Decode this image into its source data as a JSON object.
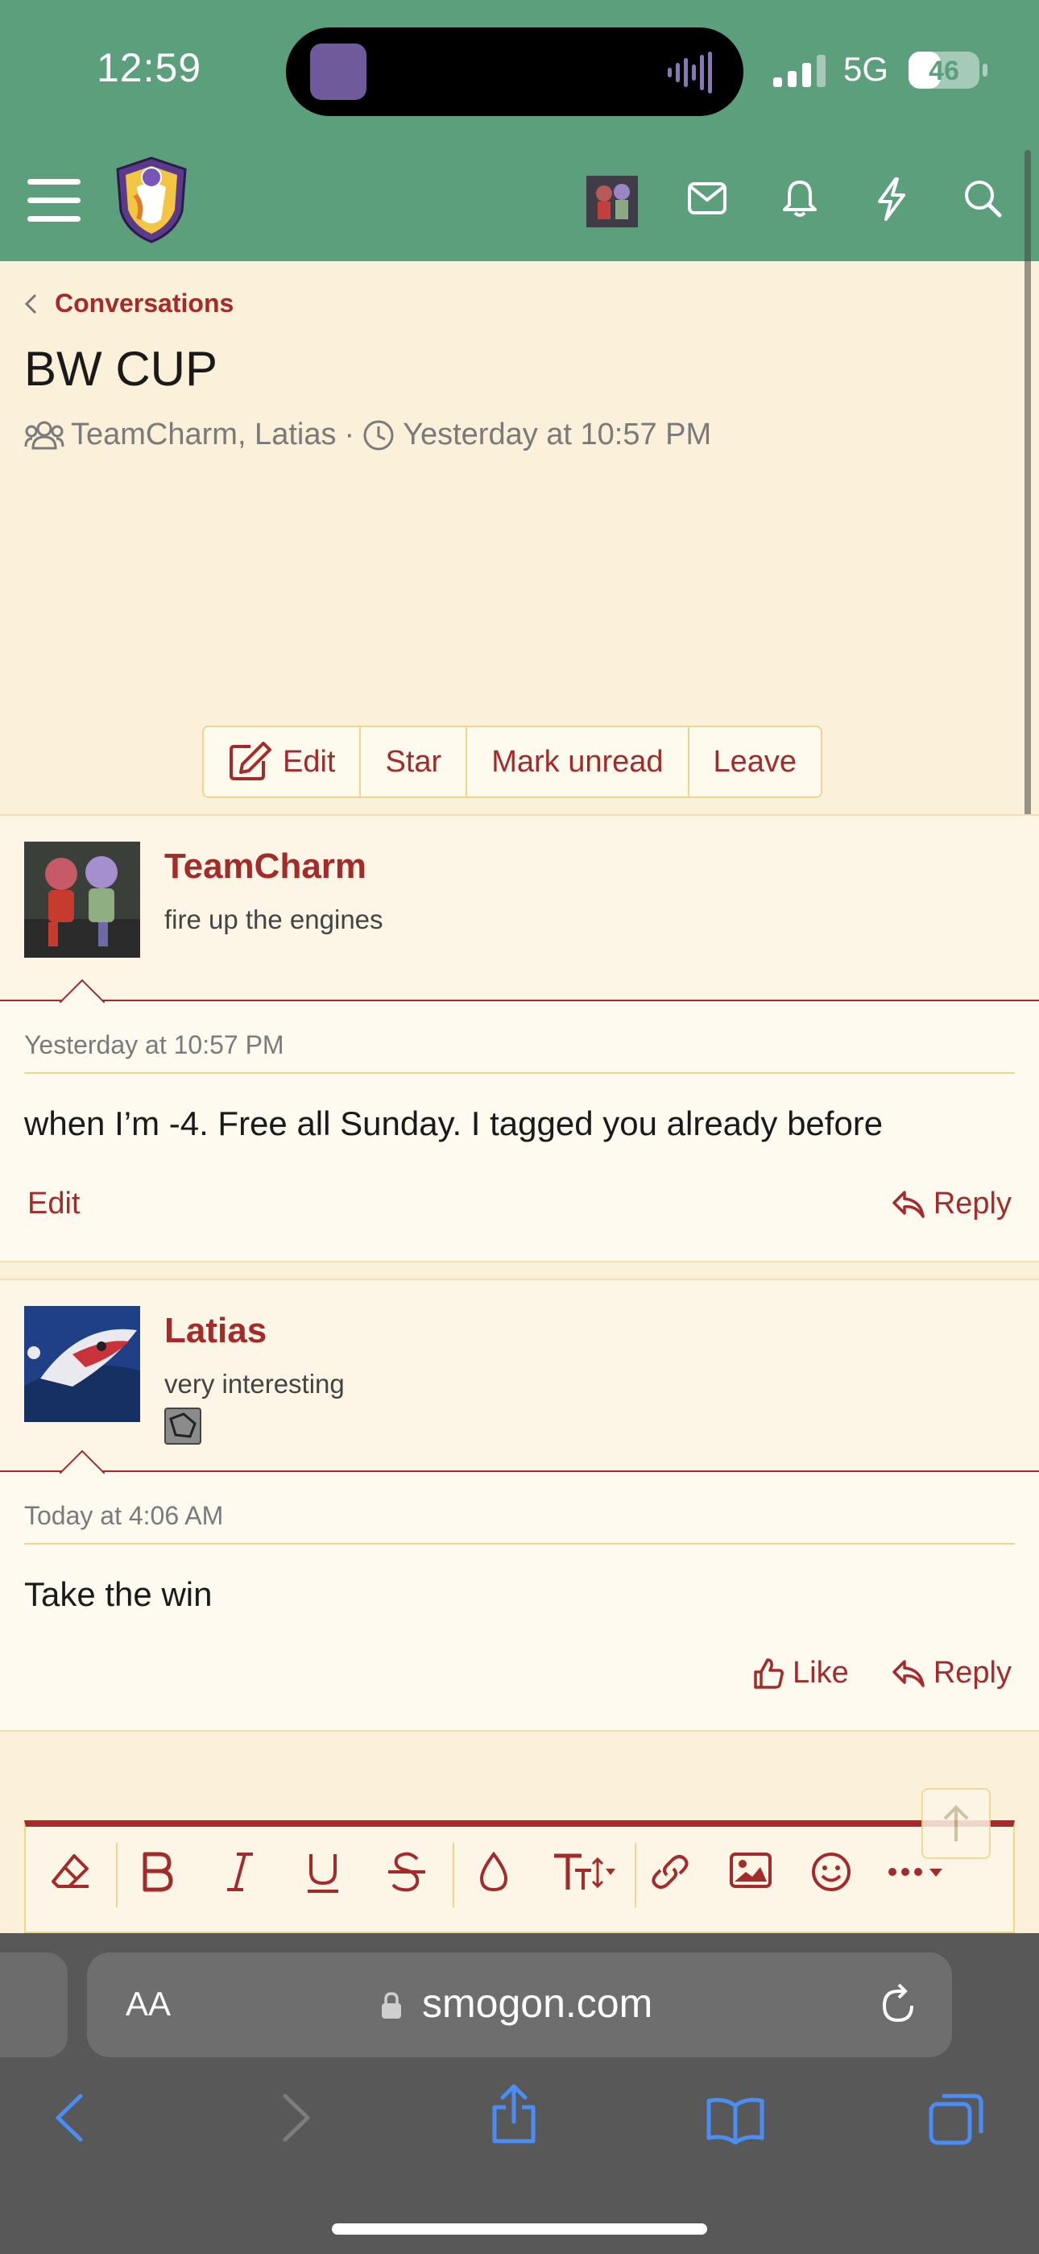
{
  "status_bar": {
    "time": "12:59",
    "network": "5G",
    "battery": "46",
    "battery_level": 0.46
  },
  "breadcrumb": {
    "label": "Conversations"
  },
  "conversation": {
    "title": "BW CUP",
    "participants": "TeamCharm, Latias",
    "separator": "·",
    "started": "Yesterday at 10:57 PM"
  },
  "actions": {
    "edit": "Edit",
    "star": "Star",
    "mark_unread": "Mark unread",
    "leave": "Leave"
  },
  "messages": [
    {
      "username": "TeamCharm",
      "user_title": "fire up the engines",
      "date": "Yesterday at 10:57 PM",
      "body": "when I’m -4. Free all Sunday. I tagged you already before",
      "edit_label": "Edit",
      "reply_label": "Reply"
    },
    {
      "username": "Latias",
      "user_title": "very interesting",
      "date": "Today at 4:06 AM",
      "body": "Take the win",
      "like_label": "Like",
      "reply_label": "Reply"
    }
  ],
  "browser": {
    "aa_label": "AA",
    "url": "smogon.com"
  },
  "colors": {
    "nav": "#5b9f7c",
    "accent": "#a52a2a",
    "background": "#fbf0d9",
    "border": "#f0d68c"
  },
  "icons": [
    "menu-icon",
    "mail-icon",
    "bell-icon",
    "lightning-icon",
    "search-icon",
    "users-icon",
    "clock-icon",
    "reply-icon",
    "thumbs-up-icon"
  ]
}
